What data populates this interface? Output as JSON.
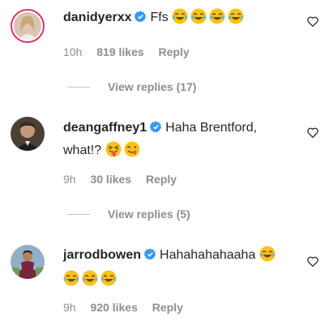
{
  "comments": [
    {
      "username": "danidyerxx",
      "text": "Ffs",
      "emojis": [
        "face-with-tears-of-joy",
        "face-with-tears-of-joy",
        "face-with-tears-of-joy",
        "face-with-tears-of-joy"
      ],
      "time": "10h",
      "likes": "819 likes",
      "reply": "Reply",
      "view_replies": "View replies (17)"
    },
    {
      "username": "deangaffney1",
      "text_line1": "Haha Brentford,",
      "text_line2": "what!?",
      "emojis": [
        "squinting-face-with-tongue",
        "face-savoring-food"
      ],
      "time": "9h",
      "likes": "30 likes",
      "reply": "Reply",
      "view_replies": "View replies (5)"
    },
    {
      "username": "jarrodbowen",
      "text": "Hahahahahaaha",
      "emojis": [
        "face-with-tears-of-joy",
        "face-with-tears-of-joy",
        "face-with-tears-of-joy",
        "face-with-tears-of-joy"
      ],
      "time": "9h",
      "likes": "920 likes",
      "reply": "Reply"
    }
  ],
  "colors": {
    "text": "#262626",
    "secondary": "#8e8e8e",
    "verified": "#3897f0",
    "emoji_face": "#fcc21b",
    "story_ring": "#e1306c"
  }
}
